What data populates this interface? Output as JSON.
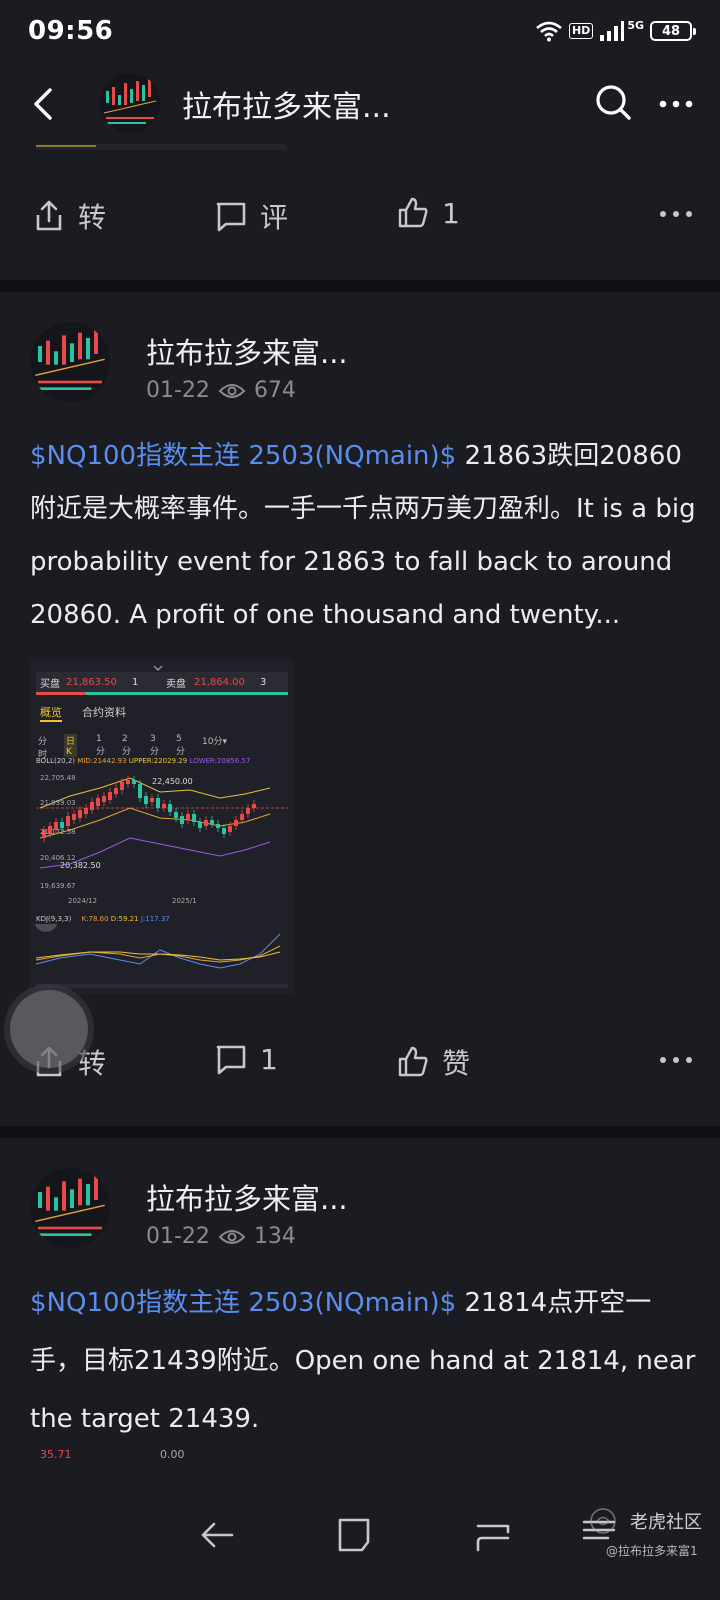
{
  "status_bar": {
    "time": "09:56",
    "hd_label": "HD",
    "network_label": "5G",
    "battery": "48"
  },
  "nav": {
    "title": "拉布拉多来富..."
  },
  "post0_actions": {
    "share_label": "转",
    "comment_label": "评",
    "like_count": "1"
  },
  "post1": {
    "author": "拉布拉多来富...",
    "date": "01-22",
    "views": "674",
    "tag": "$NQ100指数主连 2503(NQmain)$",
    "text": " 21863跌回20860附近是大概率事件。一手一千点两万美刀盈利。It is a big probability event for 21863 to fall back to around 20860. A profit of one thousand and twenty...",
    "share_label": "转",
    "comment_count": "1",
    "like_label": "赞",
    "chart": {
      "bid_label": "买盘",
      "bid_price": "21,863.50",
      "bid_qty": "1",
      "ask_label": "卖盘",
      "ask_price": "21,864.00",
      "ask_qty": "3",
      "tab_overview": "概览",
      "tab_contract": "合约资料",
      "periods": [
        "分时",
        "日K",
        "1分",
        "2分",
        "3分",
        "5分",
        "10分▾"
      ],
      "boll_label": "BOLL(20,2)",
      "boll_mid": "MID:21442.93",
      "boll_upper": "UPPER:22029.29",
      "boll_lower": "LOWER:20856.57",
      "y_ticks": [
        "22,705.48",
        "21,939.03",
        "21,172.58",
        "20,406.12",
        "19,639.67"
      ],
      "annotation_high": "22,450.00",
      "annotation_low": "20,382.50",
      "x_ticks": [
        "2024/12",
        "2025/1"
      ],
      "kdj_label": "KDJ(9,3,3)",
      "kdj_k": "K:78.60",
      "kdj_d": "D:59.21",
      "kdj_j": "J:117.37",
      "colors": {
        "up": "#e84a4a",
        "down": "#2bc4a0",
        "mid": "#e8a33a",
        "upper": "#e8c23a",
        "lower": "#9a5be8"
      }
    }
  },
  "post2": {
    "author": "拉布拉多来富...",
    "date": "01-22",
    "views": "134",
    "tag": "$NQ100指数主连 2503(NQmain)$",
    "text": " 21814点开空一手，目标21439附近。Open one hand at 21814, near the target 21439.",
    "peek_left": "35.71",
    "peek_right": "0.00"
  },
  "watermark": {
    "brand": "老虎社区",
    "user": "@拉布拉多来富1"
  }
}
